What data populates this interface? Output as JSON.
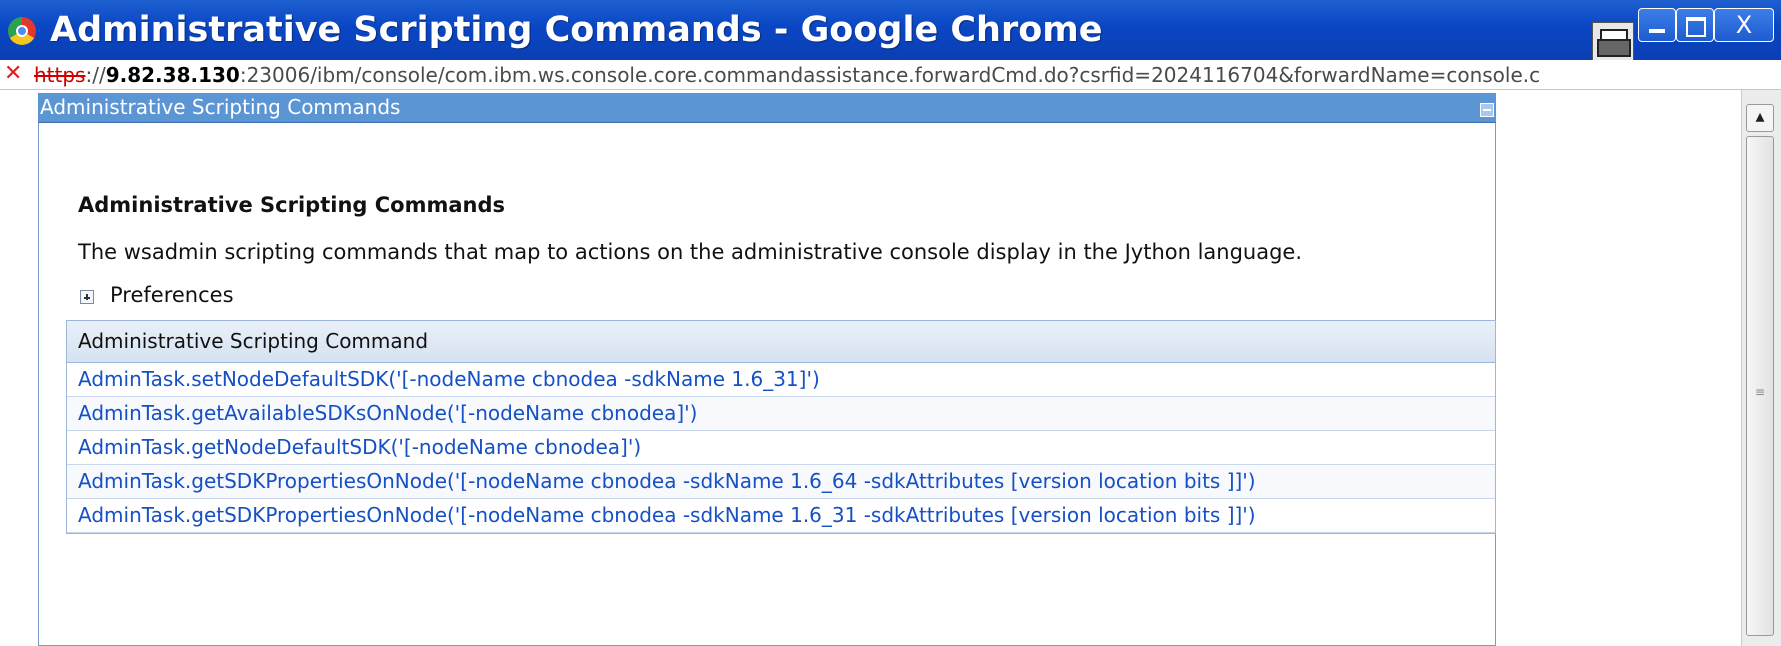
{
  "window": {
    "title": "Administrative Scripting Commands - Google Chrome",
    "close_label": "X"
  },
  "address": {
    "scheme": "https",
    "after_scheme": "://",
    "host": "9.82.38.130",
    "path": ":23006/ibm/console/com.ibm.ws.console.core.commandassistance.forwardCmd.do?csrfid=2024116704&forwardName=console.c"
  },
  "portlet": {
    "title": "Administrative Scripting Commands"
  },
  "page": {
    "heading": "Administrative Scripting Commands",
    "description": "The wsadmin scripting commands that map to actions on the administrative console display in the Jython language.",
    "preferences_label": "Preferences"
  },
  "table": {
    "header": "Administrative Scripting Command",
    "rows": [
      "AdminTask.setNodeDefaultSDK('[-nodeName cbnodea -sdkName 1.6_31]')",
      "AdminTask.getAvailableSDKsOnNode('[-nodeName cbnodea]')",
      "AdminTask.getNodeDefaultSDK('[-nodeName cbnodea]')",
      "AdminTask.getSDKPropertiesOnNode('[-nodeName cbnodea -sdkName 1.6_64 -sdkAttributes [version location bits ]]')",
      "AdminTask.getSDKPropertiesOnNode('[-nodeName cbnodea -sdkName 1.6_31 -sdkAttributes [version location bits ]]')"
    ]
  }
}
